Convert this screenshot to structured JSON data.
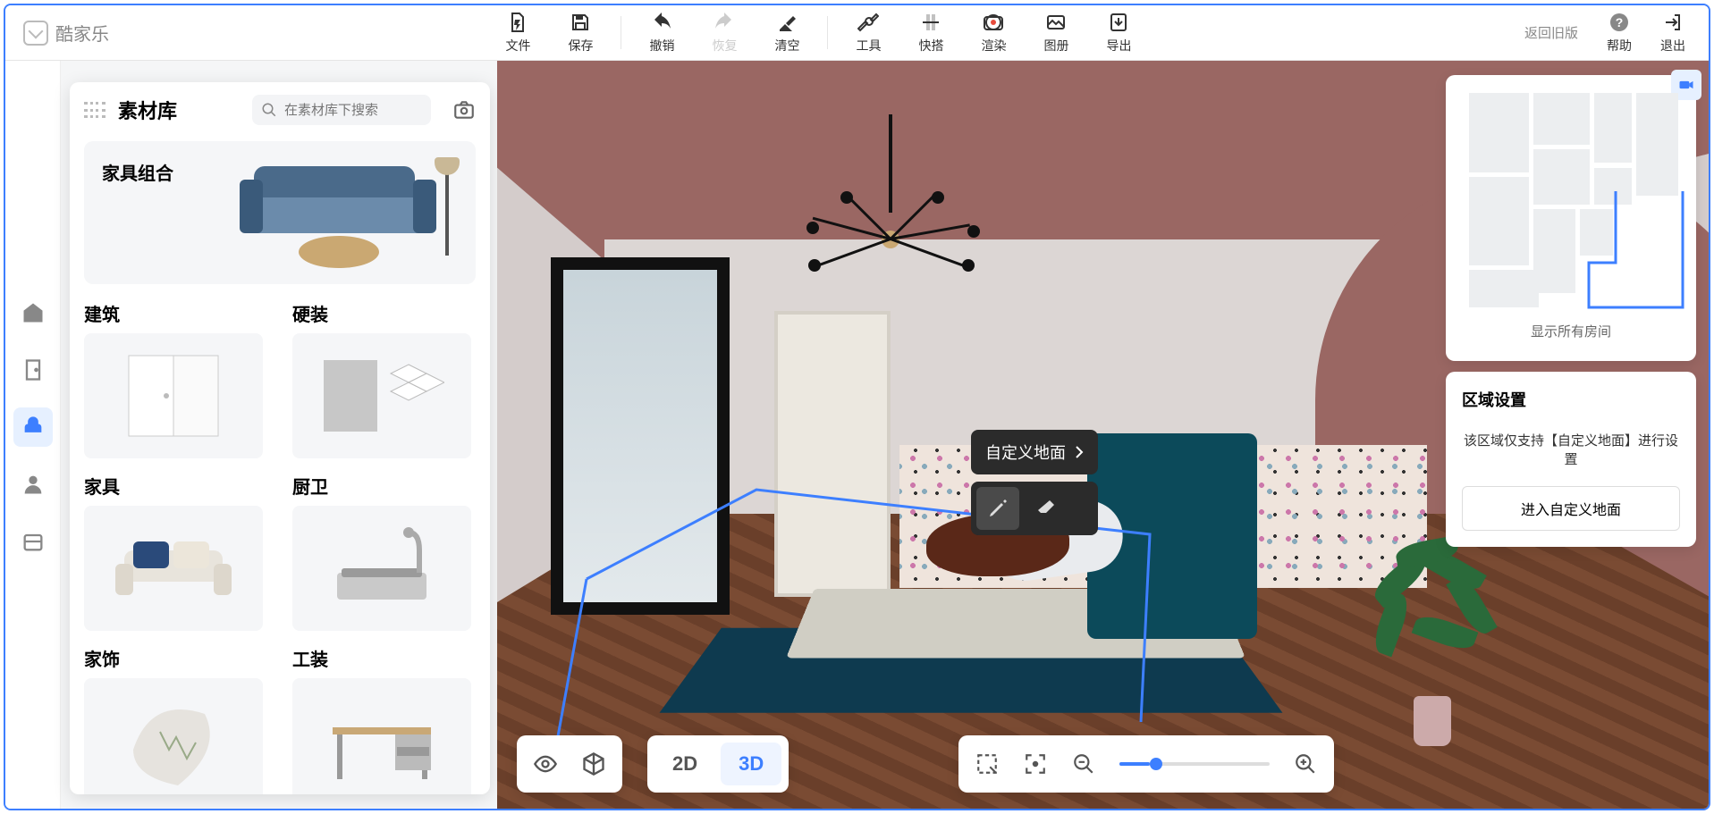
{
  "app": {
    "name": "酷家乐"
  },
  "toolbar": {
    "file": "文件",
    "save": "保存",
    "undo": "撤销",
    "redo": "恢复",
    "clear": "清空",
    "tools": "工具",
    "quick": "快搭",
    "render": "渲染",
    "album": "图册",
    "export": "导出",
    "back_old": "返回旧版",
    "help": "帮助",
    "exit": "退出"
  },
  "asset_panel": {
    "title": "素材库",
    "search_placeholder": "在素材库下搜索",
    "feature": "家具组合",
    "cats": [
      "建筑",
      "硬装",
      "家具",
      "厨卫",
      "家饰",
      "工装"
    ]
  },
  "context": {
    "label": "自定义地面"
  },
  "view_toggle": {
    "d2": "2D",
    "d3": "3D"
  },
  "minimap": {
    "show_all": "显示所有房间"
  },
  "region": {
    "title": "区域设置",
    "desc": "该区域仅支持【自定义地面】进行设置",
    "button": "进入自定义地面"
  }
}
